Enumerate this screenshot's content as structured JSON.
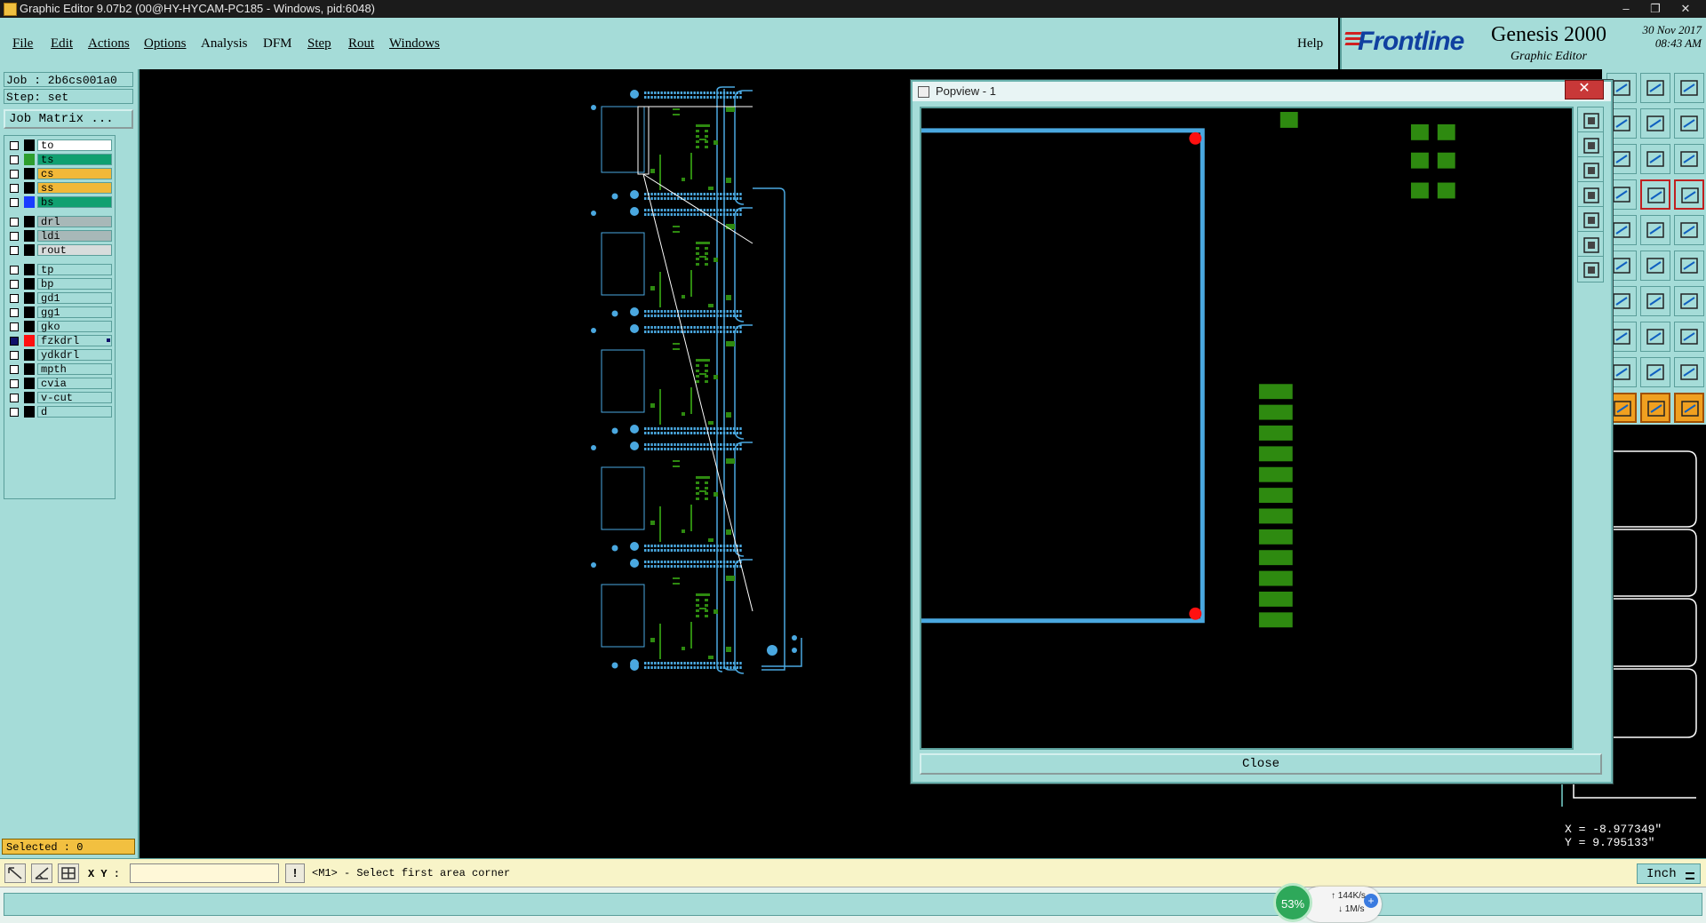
{
  "window": {
    "title": "Graphic Editor 9.07b2 (00@HY-HYCAM-PC185 - Windows, pid:6048)",
    "minimize_icon": "minimize-icon",
    "maximize_icon": "restore-icon",
    "close_icon": "close-icon"
  },
  "menu": {
    "file": "File",
    "edit": "Edit",
    "actions": "Actions",
    "options": "Options",
    "analysis": "Analysis",
    "dfm": "DFM",
    "step": "Step",
    "rout": "Rout",
    "windows": "Windows",
    "help": "Help"
  },
  "brand": {
    "logo": "Frontline",
    "product": "Genesis 2000",
    "subtitle": "Graphic Editor",
    "date": "30 Nov 2017",
    "time": "08:43 AM",
    "logo_color": "#1040a0",
    "logo_mark_color": "#d02020"
  },
  "job": {
    "job_line": "Job : 2b6cs001a0",
    "step_line": "Step: set",
    "job_matrix": "Job Matrix ..."
  },
  "layers": [
    {
      "name": "to",
      "swatch": "#000000",
      "bg": "#ffffff",
      "checked": false
    },
    {
      "name": "ts",
      "swatch": "#2e9e2e",
      "bg": "#10a070",
      "checked": false
    },
    {
      "name": "cs",
      "swatch": "#000000",
      "bg": "#f2b838",
      "checked": false
    },
    {
      "name": "ss",
      "swatch": "#000000",
      "bg": "#f2b838",
      "checked": false
    },
    {
      "name": "bs",
      "swatch": "#1a3cff",
      "bg": "#10a070",
      "checked": false
    },
    {
      "name": "drl",
      "swatch": "#000000",
      "bg": "#a8b8b8",
      "checked": false
    },
    {
      "name": "ldi",
      "swatch": "#000000",
      "bg": "#a8b8b8",
      "checked": false
    },
    {
      "name": "rout",
      "swatch": "#000000",
      "bg": "#d8dcdc",
      "checked": false
    },
    {
      "name": "tp",
      "swatch": "#000000",
      "bg": "#a5dcd8",
      "checked": false
    },
    {
      "name": "bp",
      "swatch": "#000000",
      "bg": "#a5dcd8",
      "checked": false
    },
    {
      "name": "gd1",
      "swatch": "#000000",
      "bg": "#a5dcd8",
      "checked": false
    },
    {
      "name": "gg1",
      "swatch": "#000000",
      "bg": "#a5dcd8",
      "checked": false
    },
    {
      "name": "gko",
      "swatch": "#000000",
      "bg": "#a5dcd8",
      "checked": false
    },
    {
      "name": "fzkdrl",
      "swatch": "#ff1010",
      "bg": "#a5dcd8",
      "checked": true
    },
    {
      "name": "ydkdrl",
      "swatch": "#000000",
      "bg": "#a5dcd8",
      "checked": false
    },
    {
      "name": "mpth",
      "swatch": "#000000",
      "bg": "#a5dcd8",
      "checked": false
    },
    {
      "name": "cvia",
      "swatch": "#000000",
      "bg": "#a5dcd8",
      "checked": false
    },
    {
      "name": "v-cut",
      "swatch": "#000000",
      "bg": "#a5dcd8",
      "checked": false
    },
    {
      "name": "d",
      "swatch": "#000000",
      "bg": "#a5dcd8",
      "checked": false
    }
  ],
  "selected": "Selected : 0",
  "coords": {
    "x": "X = -8.977349\"",
    "y": "Y = 9.795133\""
  },
  "command": {
    "xy_label": "X Y :",
    "xy_value": "",
    "message": "<M1> - Select first area corner",
    "units": "Inch"
  },
  "popview": {
    "title": "Popview - 1",
    "close_label": "Close"
  },
  "perf": {
    "cpu": "53%",
    "up": "144K/s",
    "down": "1M/s",
    "plus": "+"
  },
  "colors": {
    "panel": "#a5dcd8",
    "outline": "#4aa8e0",
    "pad": "#2e8a10",
    "drill": "#ff1010"
  }
}
